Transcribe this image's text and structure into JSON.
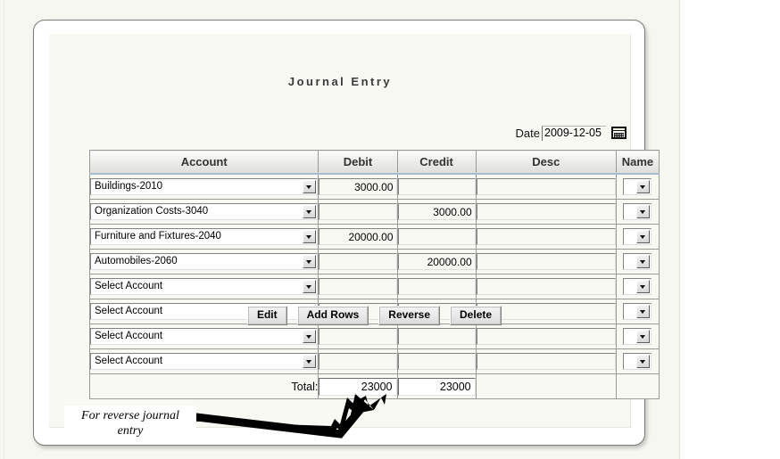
{
  "form": {
    "title": "Journal Entry",
    "date_label": "Date",
    "date_value": "2009-12-05",
    "calendar_icon": "calendar-icon"
  },
  "table": {
    "headers": [
      "Account",
      "Debit",
      "Credit",
      "Desc",
      "Name"
    ],
    "account_placeholder": "Select Account",
    "rows": [
      {
        "account": "Buildings-2010",
        "debit": "3000.00",
        "credit": "",
        "desc": "",
        "name": ""
      },
      {
        "account": "Organization Costs-3040",
        "debit": "",
        "credit": "3000.00",
        "desc": "",
        "name": ""
      },
      {
        "account": "Furniture and Fixtures-2040",
        "debit": "20000.00",
        "credit": "",
        "desc": "",
        "name": ""
      },
      {
        "account": "Automobiles-2060",
        "debit": "",
        "credit": "20000.00",
        "desc": "",
        "name": ""
      },
      {
        "account": "Select Account",
        "debit": "",
        "credit": "",
        "desc": "",
        "name": ""
      },
      {
        "account": "Select Account",
        "debit": "",
        "credit": "",
        "desc": "",
        "name": ""
      },
      {
        "account": "Select Account",
        "debit": "",
        "credit": "",
        "desc": "",
        "name": ""
      },
      {
        "account": "Select Account",
        "debit": "",
        "credit": "",
        "desc": "",
        "name": ""
      }
    ],
    "total": {
      "label": "Total:",
      "debit": "23000",
      "credit": "23000"
    }
  },
  "buttons": [
    {
      "label": "Edit",
      "name": "edit-button"
    },
    {
      "label": "Add Rows",
      "name": "add-rows-button"
    },
    {
      "label": "Reverse",
      "name": "reverse-button"
    },
    {
      "label": "Delete",
      "name": "delete-button"
    }
  ],
  "annotation": {
    "line1": "For reverse journal",
    "line2": "entry"
  },
  "colors": {
    "page_bg": "#f7f7f1",
    "panel_bg": "#ffffff",
    "inner_bg": "#f9f9f4",
    "header_border_accent": "#a8bed0",
    "text": "#000000"
  }
}
